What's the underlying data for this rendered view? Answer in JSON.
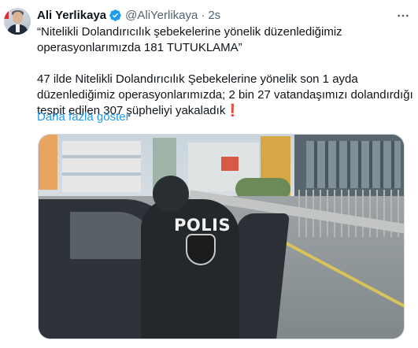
{
  "tweet": {
    "author_name": "Ali Yerlikaya",
    "handle": "@AliYerlikaya",
    "separator": "·",
    "time": "2s",
    "lines": [
      "“Nitelikli Dolandırıcılık şebekelerine yönelik düzenlediğimiz",
      "operasyonlarımızda 181 TUTUKLAMA”",
      "47 ilde Nitelikli Dolandırıcılık Şebekelerine yönelik son 1 ayda",
      "düzenlediğimiz operasyonlarımızda; 2 bin 27 vatandaşımızı dolandırdığı",
      "tespit edilen 307 şüpheliyi yakaladık"
    ],
    "emoji": "❗",
    "show_more": "Daha fazla göster"
  },
  "media": {
    "vest_text": "POLIS"
  },
  "icons": {
    "verified": "verified-badge-icon",
    "more": "more-options-icon"
  },
  "colors": {
    "link": "#1d9bf0",
    "secondary_text": "#536471",
    "verified": "#1d9bf0"
  }
}
